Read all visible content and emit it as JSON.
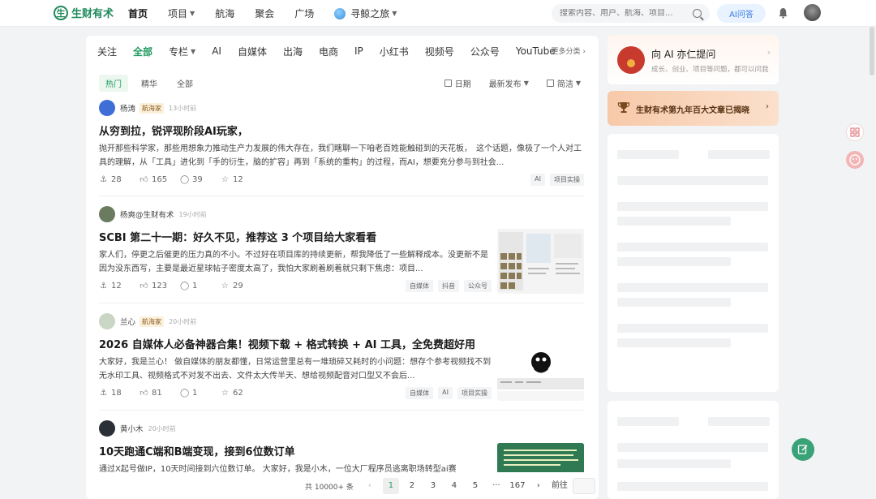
{
  "header": {
    "logo_mark": "生",
    "logo_text": "生财有术",
    "nav": [
      {
        "label": "首页",
        "active": true,
        "caret": false
      },
      {
        "label": "项目",
        "active": false,
        "caret": true
      },
      {
        "label": "航海",
        "active": false,
        "caret": false
      },
      {
        "label": "聚会",
        "active": false,
        "caret": false
      },
      {
        "label": "广场",
        "active": false,
        "caret": false
      }
    ],
    "voyage_label": "寻鲸之旅",
    "search_placeholder": "搜索内容、用户、航海、项目...",
    "ai_button": "AI问答",
    "accent": "#1e9a5e"
  },
  "categories": [
    "关注",
    "全部",
    "专栏",
    "AI",
    "自媒体",
    "出海",
    "电商",
    "IP",
    "小红书",
    "视频号",
    "公众号",
    "YouTube"
  ],
  "active_category": "全部",
  "more_categories": "更多分类",
  "subtabs": [
    "热门",
    "精华",
    "全部"
  ],
  "tools": {
    "date": "日期",
    "sort": "最新发布",
    "view": "简洁"
  },
  "posts": [
    {
      "author": "杨涛",
      "badge": "航海家",
      "time": "13小时前",
      "title": "从穷到拉，锐评现阶段AI玩家，",
      "body": "抛开那些科学家，那些用想象力推动生产力发展的伟大存在，我们瞎聊一下咱老百姓能触碰到的天花板，　这个话题，像极了一个人对工具的理解，从「工具」进化到「手的衍生，脑的扩容」再到「系统的重构」的过程，而AI，想要充分参与到社会...",
      "anchors": "28",
      "likes": "165",
      "comments": "39",
      "stars": "12",
      "tags": [
        "AI",
        "项目实操"
      ]
    },
    {
      "author": "杨爽@生财有术",
      "badge": "",
      "time": "19小时前",
      "title": "SCBI 第二十一期：好久不见，推荐这 3 个项目给大家看看",
      "body": "家人们，停更之后催更的压力真的不小。不过好在项目库的持续更新，帮我降低了一些解释成本。没更新不是因为没东西写，主要是最近星球帖子密度太高了，我怕大家刷着刷着就只剩下焦虑：项目...",
      "anchors": "12",
      "likes": "123",
      "comments": "1",
      "stars": "29",
      "tags": [
        "自媒体",
        "抖音",
        "公众号"
      ]
    },
    {
      "author": "兰心",
      "badge": "航海家",
      "time": "20小时前",
      "title": "2026 自媒体人必备神器合集！视频下载 + 格式转换 + AI 工具，全免费超好用",
      "body": "大家好，我是兰心！ 做自媒体的朋友都懂，日常运营里总有一堆琐碎又耗时的小问题：想存个参考视频找不到无水印工具、视频格式不对发不出去、文件太大传半天、想给视频配音对口型又不会后...",
      "anchors": "18",
      "likes": "81",
      "comments": "1",
      "stars": "62",
      "tags": [
        "自媒体",
        "AI",
        "项目实操"
      ]
    },
    {
      "author": "黄小木",
      "badge": "",
      "time": "20小时前",
      "title": "10天跑通C端和B端变现，接到6位数订单",
      "body": "通过X起号做IP，10天时间接到六位数订单。 大家好，我是小木，一位大厂程序员逃离职场转型ai赛",
      "anchors": "",
      "likes": "",
      "comments": "",
      "stars": "",
      "tags": []
    }
  ],
  "pagination": {
    "total": "共 10000+ 条",
    "prev": "‹",
    "pages": [
      "1",
      "2",
      "3",
      "4",
      "5"
    ],
    "ellipsis": "···",
    "last": "167",
    "next": "›",
    "goto": "前往",
    "current": "1"
  },
  "sidebar": {
    "ask_title": "向 AI 亦仁提问",
    "ask_sub": "成长、创业、项目等问题，都可以问我",
    "rank_text": "生财有术第九年百大文章已揭晓"
  }
}
